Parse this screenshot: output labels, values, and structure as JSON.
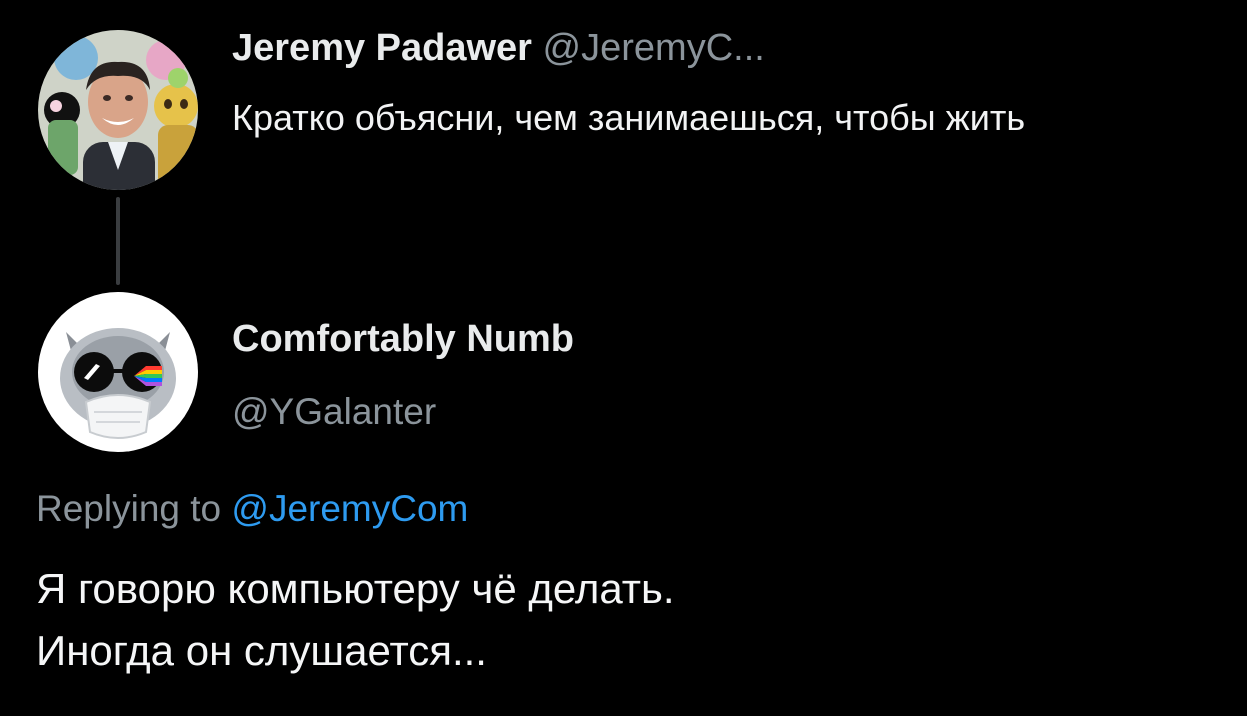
{
  "original_tweet": {
    "display_name": "Jeremy Padawer",
    "handle": "@JeremyC...",
    "avatar_icon": "profile-photo-man-with-toys",
    "text": "Кратко объясни, чем занимаешься, чтобы жить"
  },
  "reply_tweet": {
    "display_name": "Comfortably Numb",
    "handle": "@YGalanter",
    "avatar_icon": "cat-with-prism-glasses",
    "replying_prefix": "Replying to",
    "replying_mention": "@JeremyCom",
    "text_lines": [
      "Я говорю компьютеру чё делать.",
      "Иногда он слушается..."
    ]
  },
  "colors": {
    "background": "#000000",
    "text_primary": "#f2f3f4",
    "text_secondary": "#8b949b",
    "mention": "#2e9bf0",
    "thread_line": "#3a3d40"
  }
}
